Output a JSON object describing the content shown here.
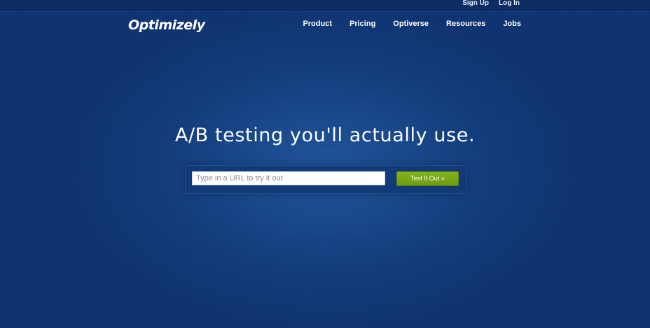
{
  "topbar": {
    "links": [
      {
        "label": "Sign Up"
      },
      {
        "label": "Log In"
      }
    ]
  },
  "header": {
    "logo_text": "Optimizely",
    "nav": [
      {
        "label": "Product"
      },
      {
        "label": "Pricing"
      },
      {
        "label": "Optiverse"
      },
      {
        "label": "Resources"
      },
      {
        "label": "Jobs"
      }
    ]
  },
  "hero": {
    "headline": "A/B testing you'll actually use.",
    "url_input": {
      "value": "",
      "placeholder": "Type in a URL to try it out"
    },
    "submit_label": "Test It Out »"
  },
  "colors": {
    "background": "#0f3572",
    "accent_green": "#7aaa16",
    "text": "#ffffff"
  }
}
